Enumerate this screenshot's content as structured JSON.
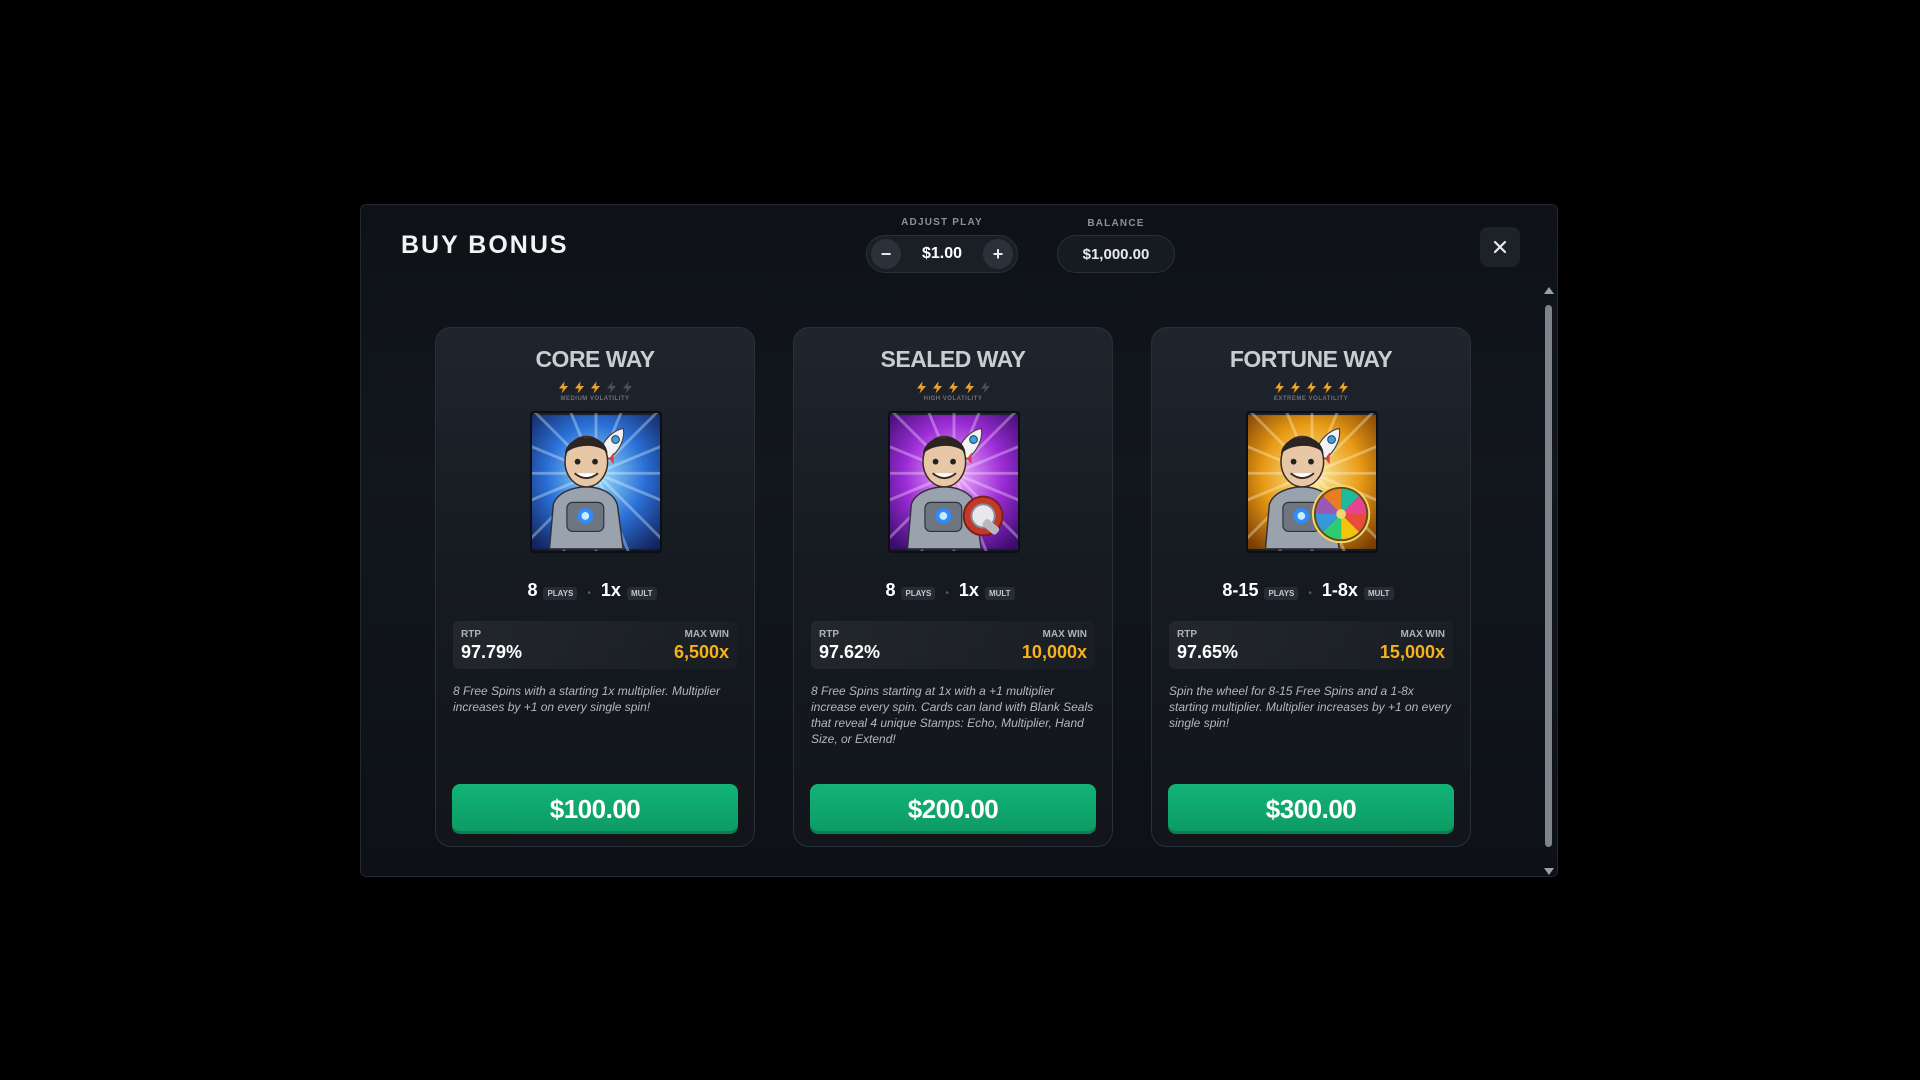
{
  "modal": {
    "title": "BUY BONUS",
    "adjust_play_label": "ADJUST PLAY",
    "play_value": "$1.00",
    "minus": "−",
    "plus": "+",
    "balance_label": "BALANCE",
    "balance_value": "$1,000.00"
  },
  "cards": [
    {
      "title": "CORE WAY",
      "bolts_active": 3,
      "bolts_total": 5,
      "volatility": "MEDIUM VOLATILITY",
      "art_theme": "blue",
      "plays": "8",
      "plays_unit": "PLAYS",
      "mult": "1x",
      "mult_unit": "MULT",
      "rtp_label": "RTP",
      "rtp": "97.79%",
      "maxwin_label": "MAX WIN",
      "maxwin": "6,500x",
      "description": "8 Free Spins with a starting 1x multiplier. Multiplier increases by +1 on every single spin!",
      "price": "$100.00"
    },
    {
      "title": "SEALED WAY",
      "bolts_active": 4,
      "bolts_total": 5,
      "volatility": "HIGH VOLATILITY",
      "art_theme": "purple",
      "plays": "8",
      "plays_unit": "PLAYS",
      "mult": "1x",
      "mult_unit": "MULT",
      "rtp_label": "RTP",
      "rtp": "97.62%",
      "maxwin_label": "MAX WIN",
      "maxwin": "10,000x",
      "description": "8 Free Spins starting at 1x with a +1 multiplier increase every spin. Cards can land with Blank Seals that reveal 4 unique Stamps: Echo, Multiplier, Hand Size, or Extend!",
      "price": "$200.00"
    },
    {
      "title": "FORTUNE WAY",
      "bolts_active": 5,
      "bolts_total": 5,
      "volatility": "EXTREME VOLATILITY",
      "art_theme": "gold",
      "plays": "8-15",
      "plays_unit": "PLAYS",
      "mult": "1-8x",
      "mult_unit": "MULT",
      "rtp_label": "RTP",
      "rtp": "97.65%",
      "maxwin_label": "MAX WIN",
      "maxwin": "15,000x",
      "description": "Spin the wheel for 8-15 Free Spins and a 1-8x starting multiplier. Multiplier increases by +1 on every single spin!",
      "price": "$300.00"
    }
  ],
  "icons": {
    "close": "close-icon",
    "bolt": "lightning-bolt-icon",
    "scroll_up": "scroll-up-arrow-icon",
    "scroll_down": "scroll-down-arrow-icon"
  },
  "colors": {
    "accent_green": "#12b377",
    "maxwin_gold": "#f5b21b",
    "bolt_active": "#f2a31a",
    "bolt_inactive": "#4a4f56"
  }
}
